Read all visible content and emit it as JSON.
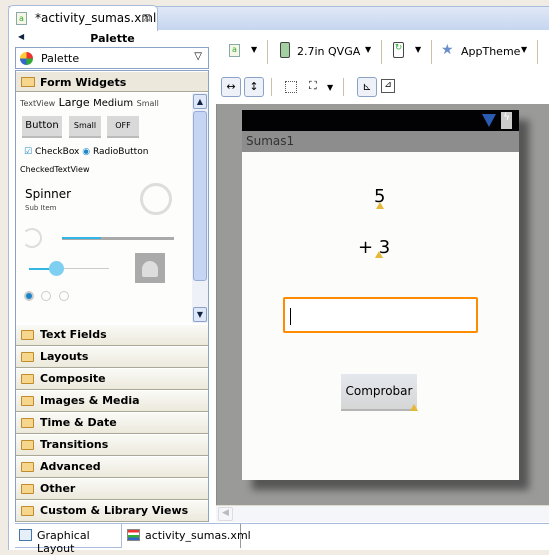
{
  "editor_tab": {
    "title": "*activity_sumas.xml"
  },
  "palette": {
    "header": "Palette",
    "dropdown": "Palette",
    "open_category": "Form Widgets",
    "widgets": {
      "textview": "TextView",
      "large": "Large",
      "medium": "Medium",
      "small": "Small",
      "button": "Button",
      "small_button": "Small",
      "toggle": "OFF",
      "checkbox": "CheckBox",
      "radio": "RadioButton",
      "checked_textview": "CheckedTextView",
      "spinner": "Spinner",
      "spinner_sub": "Sub Item"
    },
    "categories": [
      "Text Fields",
      "Layouts",
      "Composite",
      "Images & Media",
      "Time & Date",
      "Transitions",
      "Advanced",
      "Other",
      "Custom & Library Views"
    ]
  },
  "toolbar": {
    "device": "2.7in QVGA",
    "theme": "AppTheme"
  },
  "device_screen": {
    "app_title": "Sumas1",
    "number1": "5",
    "number2": "+ 3",
    "answer_value": "",
    "button_label": "Comprobar"
  },
  "bottom_tabs": [
    "Graphical Layout",
    "activity_sumas.xml"
  ],
  "colors": {
    "focus": "#ff8c00",
    "canvas": "#9a9b98",
    "selection": "#c7d5f4"
  }
}
